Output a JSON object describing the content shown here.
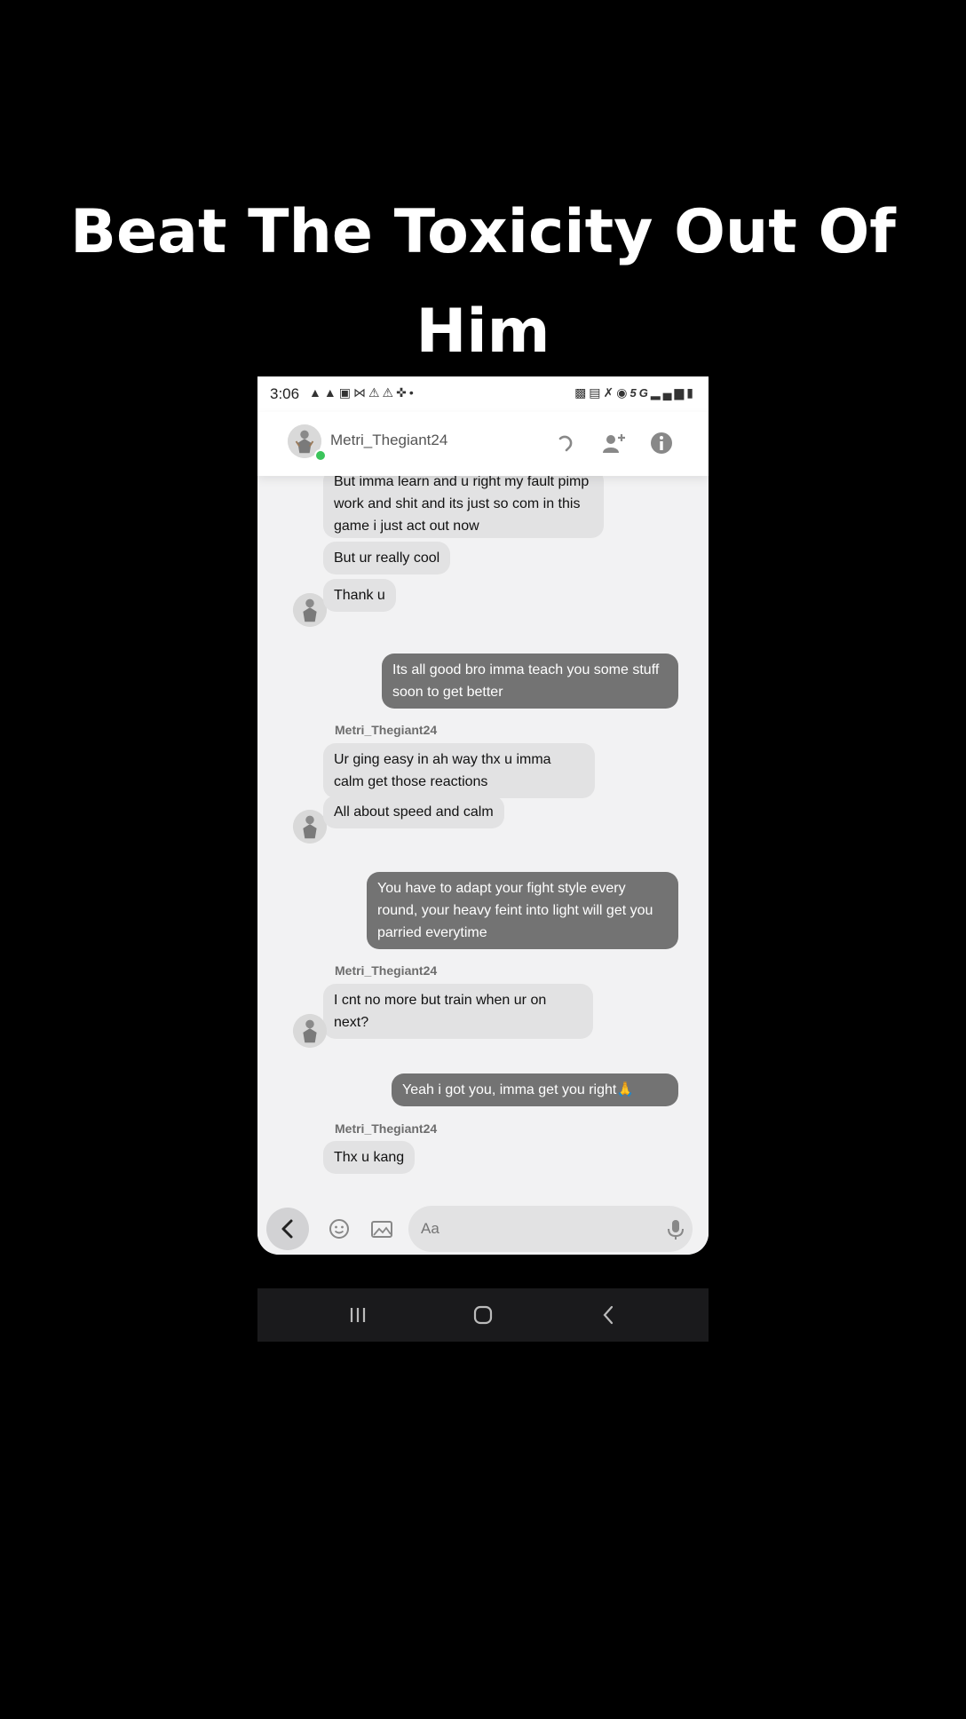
{
  "caption": {
    "line1": "Beat The Toxicity Out Of",
    "line2": "Him"
  },
  "status_bar": {
    "time": "3:06",
    "network": "5G",
    "left_icons": [
      "snapchat-icon",
      "snapchat-icon",
      "twitch-icon",
      "bowtie-icon",
      "warning-icon",
      "warning-icon",
      "walking-icon",
      "dot-icon"
    ],
    "right_icons": [
      "battery-saver-icon",
      "nfc-icon",
      "mute-icon",
      "location-icon",
      "signal-icon",
      "battery-icon"
    ]
  },
  "header": {
    "contact_name": "Metri_Thegiant24",
    "online_color": "#3bc45b",
    "icons": [
      "call-icon",
      "add-user-icon",
      "info-icon"
    ]
  },
  "messages": [
    {
      "type": "received",
      "text": "But imma learn and u right my fault pimp work and shit and its just so com in this game i just act out now"
    },
    {
      "type": "received",
      "text": "But ur really cool"
    },
    {
      "type": "received",
      "text": "Thank u"
    },
    {
      "type": "sent",
      "text": "Its all good bro imma teach you some stuff soon to get better"
    },
    {
      "type": "sender",
      "text": "Metri_Thegiant24"
    },
    {
      "type": "received",
      "text": "Ur ging easy in ah way thx u imma calm get those reactions"
    },
    {
      "type": "received",
      "text": "All about speed and calm"
    },
    {
      "type": "sent",
      "text": "You have to adapt your fight style every round, your heavy feint into light will get you parried everytime"
    },
    {
      "type": "sender",
      "text": "Metri_Thegiant24"
    },
    {
      "type": "received",
      "text": "I cnt no more but train when ur on next?"
    },
    {
      "type": "sent",
      "text": "Yeah i got you, imma get you right🙏"
    },
    {
      "type": "sender",
      "text": "Metri_Thegiant24"
    },
    {
      "type": "received",
      "text": "Thx u kang"
    }
  ],
  "composer": {
    "placeholder": "Aa"
  },
  "colors": {
    "sent_bubble": "#737373",
    "received_bubble": "#e2e2e3",
    "chat_background": "#f2f2f3"
  }
}
